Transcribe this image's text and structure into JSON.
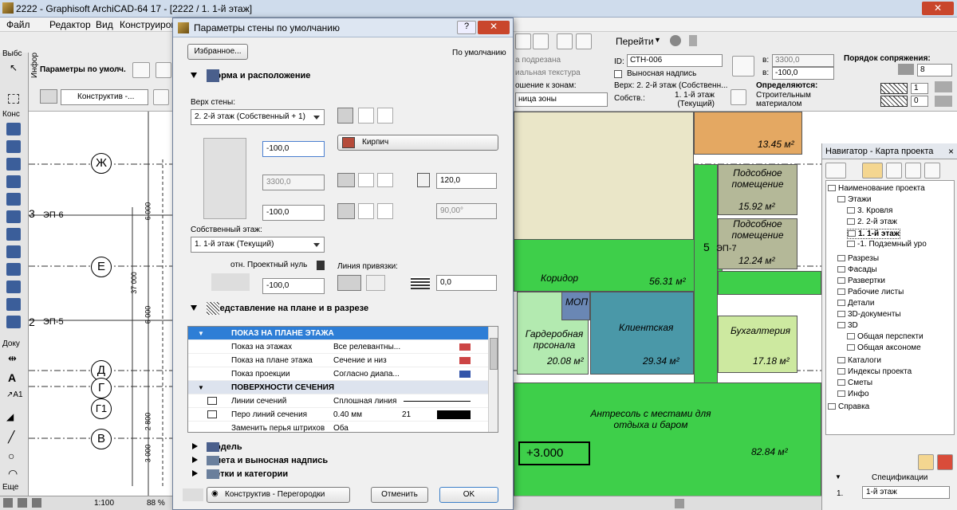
{
  "window": {
    "title": "2222 - Graphisoft ArchiCAD-64 17 - [2222 / 1. 1-й этаж]",
    "close": "✕"
  },
  "menu": [
    "Файл",
    "Редактор",
    "Вид",
    "Конструиров"
  ],
  "toolbar": {
    "goto_label": "Перейти"
  },
  "infobox": {
    "left_label": "Параметры по умолч.",
    "structure_label": "Конструктив -...",
    "id_label": "ID:",
    "id_value": "СТН-006",
    "b_label": "в:",
    "b_value": "3300,0",
    "depth_value": "-100,0",
    "depth_label": "в:",
    "order_label": "Порядок сопряжения:",
    "order_value": "8",
    "pen1_value": "1",
    "pen2_value": "0",
    "flag1": "а подрезана",
    "flag2": "иальная текстура",
    "flag3": "Выносная надпись",
    "zone_label": "ошение к зонам:",
    "zone_value": "ница зоны",
    "top_label": "Верх: 2. 2-й этаж (Собственн...",
    "own_label": "Собств.:",
    "own_value": "1. 1-й этаж (Текущий)",
    "defined_label": "Определяются:",
    "material_label": "Строительным материалом",
    "vybs": "Выбс",
    "kons": "Конс",
    "doku": "Доку",
    "eshe": "Еще",
    "infor": "Инфор"
  },
  "plan": {
    "axes": [
      "Ж",
      "Е",
      "Д",
      "Г",
      "Г1",
      "В"
    ],
    "ep_labels": [
      "ЭП-6",
      "ЭП-5",
      "ЭП-7"
    ],
    "axis_nums": [
      "3",
      "2",
      "5"
    ],
    "dims": [
      "6 000",
      "37 000",
      "6 000",
      "2 800",
      "3 000"
    ],
    "rooms": [
      {
        "name": "Подсобное помещение",
        "area": "15.92 м²"
      },
      {
        "name": "Подсобное помещение",
        "area": "12.24 м²"
      },
      {
        "name": "Коридор",
        "area": "56.31 м²"
      },
      {
        "name": "МОП",
        "area": ""
      },
      {
        "name": "Гардеробная прсонала",
        "area": "20.08 м²"
      },
      {
        "name": "Клиентская",
        "area": "29.34 м²"
      },
      {
        "name": "Бухгалтерия",
        "area": "17.18 м²"
      },
      {
        "name": "Антресоль с местами для отдыха и баром",
        "area": "82.84 м²"
      },
      {
        "name": "",
        "area": "13.45 м²"
      }
    ],
    "level_mark": "+3.000"
  },
  "navigator": {
    "title": "Навигатор - Карта проекта",
    "close": "×",
    "items": [
      {
        "label": "Наименование проекта",
        "depth": 0
      },
      {
        "label": "Этажи",
        "depth": 1
      },
      {
        "label": "3. Кровля",
        "depth": 2
      },
      {
        "label": "2. 2-й этаж",
        "depth": 2
      },
      {
        "label": "1. 1-й этаж",
        "depth": 2
      },
      {
        "label": "-1. Подземный уро",
        "depth": 2
      },
      {
        "label": "Разрезы",
        "depth": 1
      },
      {
        "label": "Фасады",
        "depth": 1
      },
      {
        "label": "Развертки",
        "depth": 1
      },
      {
        "label": "Рабочие листы",
        "depth": 1
      },
      {
        "label": "Детали",
        "depth": 1
      },
      {
        "label": "3D-документы",
        "depth": 1
      },
      {
        "label": "3D",
        "depth": 1
      },
      {
        "label": "Общая перспекти",
        "depth": 2
      },
      {
        "label": "Общая аксономе",
        "depth": 2
      },
      {
        "label": "Каталоги",
        "depth": 1
      },
      {
        "label": "Индексы проекта",
        "depth": 1
      },
      {
        "label": "Сметы",
        "depth": 1
      },
      {
        "label": "Инфо",
        "depth": 1
      },
      {
        "label": "Справка",
        "depth": 0
      }
    ],
    "spec_label": "Спецификации",
    "spec_num": "1.",
    "spec_value": "1-й этаж"
  },
  "status": {
    "scale": "1:100",
    "zoom": "88 %"
  },
  "dialog": {
    "title": "Параметры стены по умолчанию",
    "help": "?",
    "close": "✕",
    "favorites": "Избранное...",
    "default_label": "По умолчанию",
    "sec_geometry": "Форма и расположение",
    "top_label": "Верх стены:",
    "top_value": "2. 2-й этаж (Собственный + 1)",
    "offset_top": "-100,0",
    "height": "3300,0",
    "offset_bottom": "-100,0",
    "own_story_label": "Собственный этаж:",
    "own_story_value": "1. 1-й этаж (Текущий)",
    "rel_label": "отн. Проектный нуль",
    "elev": "-100,0",
    "material": "Кирпич",
    "thickness": "120,0",
    "angle": "90,00°",
    "ref_line_label": "Линия привязки:",
    "ref_offset": "0,0",
    "sec_plan": "Представление на плане и в разрезе",
    "table": [
      {
        "type": "hdr",
        "label": "ПОКАЗ НА ПЛАНЕ ЭТАЖА",
        "value": "",
        "extra": ""
      },
      {
        "type": "row",
        "label": "Показ на этажах",
        "value": "Все релевантны...",
        "extra": ""
      },
      {
        "type": "row",
        "label": "Показ на плане этажа",
        "value": "Сечение и низ",
        "extra": ""
      },
      {
        "type": "row",
        "label": "Показ проекции",
        "value": "Согласно диапа...",
        "extra": ""
      },
      {
        "type": "hdr",
        "label": "ПОВЕРХНОСТИ СЕЧЕНИЯ",
        "value": "",
        "extra": ""
      },
      {
        "type": "row",
        "label": "Линии сечений",
        "value": "Сплошная линия",
        "extra": ""
      },
      {
        "type": "row",
        "label": "Перо линий сечения",
        "value": "0.40 мм",
        "extra": "21"
      },
      {
        "type": "row",
        "label": "Заменить перья штрихов",
        "value": "Оба",
        "extra": ""
      }
    ],
    "sec_model": "Модель",
    "sec_listing": "Смета и выносная надпись",
    "sec_tags": "Метки и категории",
    "structure": "Конструктив - Перегородки",
    "cancel": "Отменить",
    "ok": "OK"
  }
}
